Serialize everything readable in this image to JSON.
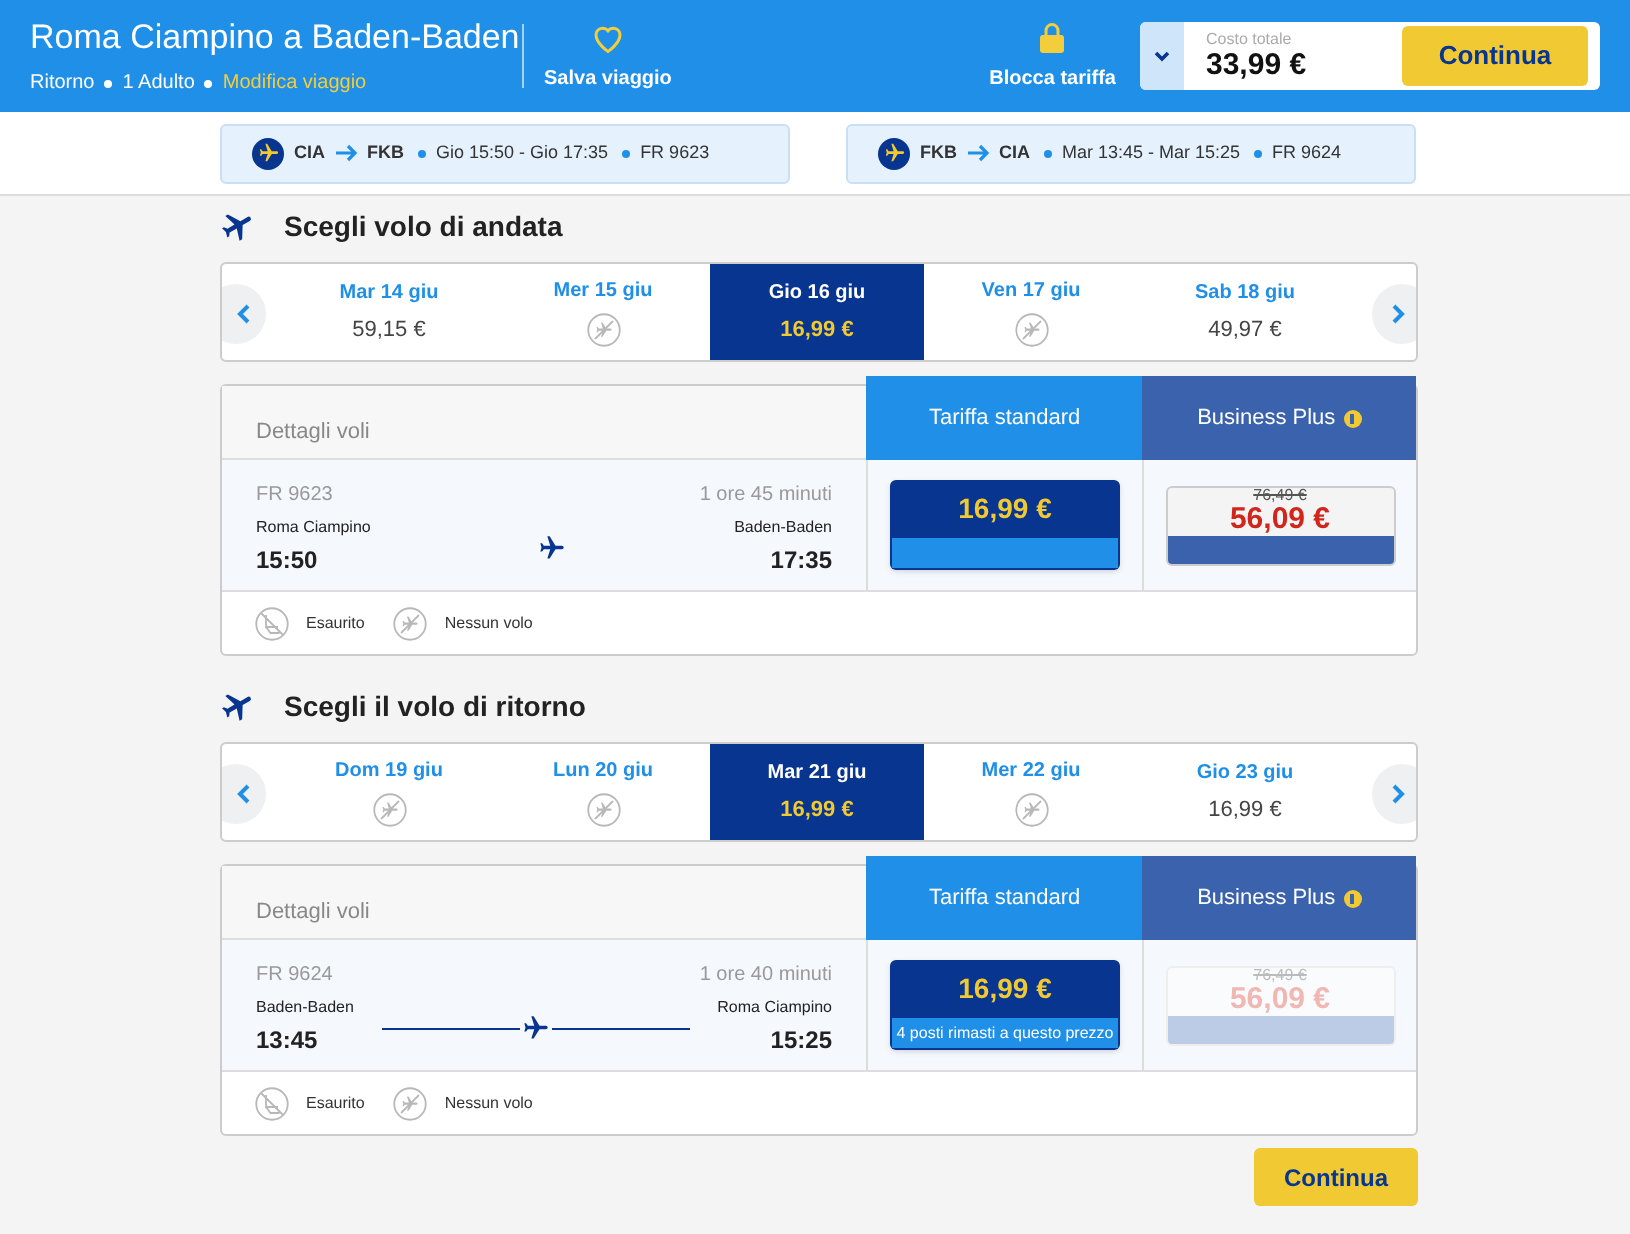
{
  "header": {
    "title": "Roma Ciampino a Baden-Baden",
    "trip": [
      "Ritorno",
      "1 Adulto"
    ],
    "edit_link": "Modifica viaggio",
    "save": "Salva viaggio",
    "lock": "Blocca tariffa",
    "total_label": "Costo totale",
    "total": "33,99 €",
    "continue": "Continua"
  },
  "summary": [
    {
      "from": "CIA",
      "to": "FKB",
      "times": "Gio 15:50 - Gio 17:35",
      "flight": "FR 9623"
    },
    {
      "from": "FKB",
      "to": "CIA",
      "times": "Mar 13:45 - Mar 15:25",
      "flight": "FR 9624"
    }
  ],
  "sections": [
    {
      "title": "Scegli volo di andata",
      "dates": [
        {
          "label": "Mar 14 giu",
          "kind": "price",
          "price": "59,15 €",
          "selected": false
        },
        {
          "label": "Mer 15 giu",
          "kind": "no_flight",
          "selected": false
        },
        {
          "label": "Gio 16 giu",
          "kind": "price",
          "price": "16,99 €",
          "selected": true
        },
        {
          "label": "Ven 17 giu",
          "kind": "no_flight",
          "selected": false
        },
        {
          "label": "Sab 18 giu",
          "kind": "price",
          "price": "49,97 €",
          "selected": false
        }
      ],
      "details_label": "Dettagli voli",
      "fare_tabs": [
        "Tariffa standard",
        "Business Plus"
      ],
      "flight": {
        "number": "FR 9623",
        "duration": "1 ore 45 minuti",
        "from": "Roma Ciampino",
        "departure": "15:50",
        "to": "Baden-Baden",
        "arrival": "17:35",
        "route_line": false
      },
      "standard": {
        "price": "16,99 €"
      },
      "business": {
        "old_price": "76,49 €",
        "price": "56,09 €",
        "disabled": false
      },
      "legend": [
        {
          "kind": "sold_out",
          "label": "Esaurito"
        },
        {
          "kind": "no_flight",
          "label": "Nessun volo"
        }
      ]
    },
    {
      "title": "Scegli il volo di ritorno",
      "dates": [
        {
          "label": "Dom 19 giu",
          "kind": "no_flight",
          "selected": false
        },
        {
          "label": "Lun 20 giu",
          "kind": "no_flight",
          "selected": false
        },
        {
          "label": "Mar 21 giu",
          "kind": "price",
          "price": "16,99 €",
          "selected": true
        },
        {
          "label": "Mer 22 giu",
          "kind": "no_flight",
          "selected": false
        },
        {
          "label": "Gio 23 giu",
          "kind": "price",
          "price": "16,99 €",
          "selected": false
        }
      ],
      "details_label": "Dettagli voli",
      "fare_tabs": [
        "Tariffa standard",
        "Business Plus"
      ],
      "flight": {
        "number": "FR 9624",
        "duration": "1 ore 40 minuti",
        "from": "Baden-Baden",
        "departure": "13:45",
        "to": "Roma Ciampino",
        "arrival": "15:25",
        "route_line": true
      },
      "standard": {
        "price": "16,99 €",
        "note": "4 posti rimasti a questo prezzo"
      },
      "business": {
        "old_price": "76,49 €",
        "price": "56,09 €",
        "disabled": true
      },
      "legend": [
        {
          "kind": "sold_out",
          "label": "Esaurito"
        },
        {
          "kind": "no_flight",
          "label": "Nessun volo"
        }
      ]
    }
  ],
  "continue": "Continua"
}
